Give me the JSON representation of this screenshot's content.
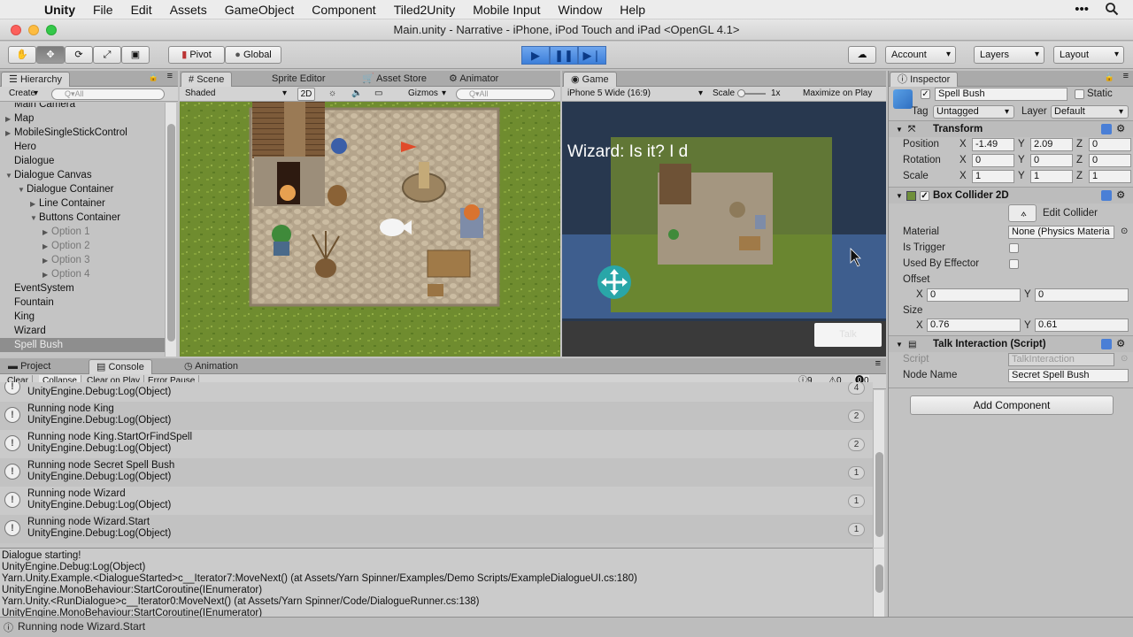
{
  "menubar": {
    "app": "Unity",
    "items": [
      "File",
      "Edit",
      "Assets",
      "GameObject",
      "Component",
      "Tiled2Unity",
      "Mobile Input",
      "Window",
      "Help"
    ]
  },
  "window": {
    "title": "Main.unity - Narrative - iPhone, iPod Touch and iPad <OpenGL 4.1>"
  },
  "toolbar": {
    "pivot": "Pivot",
    "global": "Global",
    "account": "Account",
    "layers": "Layers",
    "layout": "Layout"
  },
  "hierarchy": {
    "tab": "Hierarchy",
    "create": "Create",
    "search_placeholder": "Q▾All",
    "items": [
      {
        "label": "Main Camera",
        "depth": 0,
        "dim": false
      },
      {
        "label": "Map",
        "depth": 0,
        "dim": false
      },
      {
        "label": "MobileSingleStickControl",
        "depth": 0,
        "dim": false
      },
      {
        "label": "Hero",
        "depth": 0,
        "dim": false
      },
      {
        "label": "Dialogue",
        "depth": 0,
        "dim": false
      },
      {
        "label": "Dialogue Canvas",
        "depth": 0,
        "dim": false
      },
      {
        "label": "Dialogue Container",
        "depth": 1,
        "dim": false
      },
      {
        "label": "Line Container",
        "depth": 2,
        "dim": false
      },
      {
        "label": "Buttons Container",
        "depth": 2,
        "dim": false
      },
      {
        "label": "Option 1",
        "depth": 3,
        "dim": true
      },
      {
        "label": "Option 2",
        "depth": 3,
        "dim": true
      },
      {
        "label": "Option 3",
        "depth": 3,
        "dim": true
      },
      {
        "label": "Option 4",
        "depth": 3,
        "dim": true
      },
      {
        "label": "EventSystem",
        "depth": 0,
        "dim": false
      },
      {
        "label": "Fountain",
        "depth": 0,
        "dim": false
      },
      {
        "label": "King",
        "depth": 0,
        "dim": false
      },
      {
        "label": "Wizard",
        "depth": 0,
        "dim": false
      },
      {
        "label": "Spell Bush",
        "depth": 0,
        "dim": false
      }
    ]
  },
  "scene": {
    "tabs": [
      "Scene",
      "Sprite Editor",
      "Asset Store",
      "Animator"
    ],
    "shaded": "Shaded",
    "mode_2d": "2D",
    "gizmos": "Gizmos",
    "search_placeholder": "Q▾All"
  },
  "game": {
    "tab": "Game",
    "resolution": "iPhone 5 Wide (16:9)",
    "scale_label": "Scale",
    "scale_value": "1x",
    "maximize": "Maximize on Play",
    "dialogue_text": "Wizard: Is it? I d",
    "talk_button": "Talk"
  },
  "inspector": {
    "tab": "Inspector",
    "object_name": "Spell Bush",
    "static_label": "Static",
    "tag_label": "Tag",
    "tag_value": "Untagged",
    "layer_label": "Layer",
    "layer_value": "Default",
    "transform": {
      "title": "Transform",
      "position_label": "Position",
      "rotation_label": "Rotation",
      "scale_label": "Scale",
      "position": {
        "x": "-1.49",
        "y": "2.09",
        "z": "0"
      },
      "rotation": {
        "x": "0",
        "y": "0",
        "z": "0"
      },
      "scale": {
        "x": "1",
        "y": "1",
        "z": "1"
      }
    },
    "box_collider": {
      "title": "Box Collider 2D",
      "edit_collider": "Edit Collider",
      "material_label": "Material",
      "material_value": "None (Physics Materia",
      "is_trigger_label": "Is Trigger",
      "used_by_effector_label": "Used By Effector",
      "offset_label": "Offset",
      "offset": {
        "x": "0",
        "y": "0"
      },
      "size_label": "Size",
      "size": {
        "x": "0.76",
        "y": "0.61"
      }
    },
    "talk_interaction": {
      "title": "Talk Interaction (Script)",
      "script_label": "Script",
      "script_value": "TalkInteraction",
      "node_name_label": "Node Name",
      "node_name_value": "Secret Spell Bush"
    },
    "add_component": "Add Component",
    "axis": {
      "x": "X",
      "y": "Y",
      "z": "Z"
    }
  },
  "console": {
    "tabs": [
      "Project",
      "Console",
      "Animation"
    ],
    "buttons": [
      "Clear",
      "Collapse",
      "Clear on Play",
      "Error Pause"
    ],
    "counts": {
      "info": "9",
      "warn": "0",
      "error": "0"
    },
    "rows": [
      {
        "line1": "",
        "line2": "UnityEngine.Debug:Log(Object)",
        "count": "4"
      },
      {
        "line1": "Running node King",
        "line2": "UnityEngine.Debug:Log(Object)",
        "count": "2"
      },
      {
        "line1": "Running node King.StartOrFindSpell",
        "line2": "UnityEngine.Debug:Log(Object)",
        "count": "2"
      },
      {
        "line1": "Running node Secret Spell Bush",
        "line2": "UnityEngine.Debug:Log(Object)",
        "count": "1"
      },
      {
        "line1": "Running node Wizard",
        "line2": "UnityEngine.Debug:Log(Object)",
        "count": "1"
      },
      {
        "line1": "Running node Wizard.Start",
        "line2": "UnityEngine.Debug:Log(Object)",
        "count": "1"
      }
    ],
    "detail": [
      "Dialogue starting!",
      "UnityEngine.Debug:Log(Object)",
      "Yarn.Unity.Example.<DialogueStarted>c__Iterator7:MoveNext() (at Assets/Yarn Spinner/Examples/Demo Scripts/ExampleDialogueUI.cs:180)",
      "UnityEngine.MonoBehaviour:StartCoroutine(IEnumerator)",
      "Yarn.Unity.<RunDialogue>c__Iterator0:MoveNext() (at Assets/Yarn Spinner/Code/DialogueRunner.cs:138)",
      "UnityEngine.MonoBehaviour:StartCoroutine(IEnumerator)"
    ]
  },
  "status": {
    "text": "Running node Wizard.Start"
  },
  "colors": {
    "accent": "#3c7fd9",
    "selection": "#8e8e8e",
    "grass": "#6d8a2e",
    "stone": "#b8a88e"
  }
}
